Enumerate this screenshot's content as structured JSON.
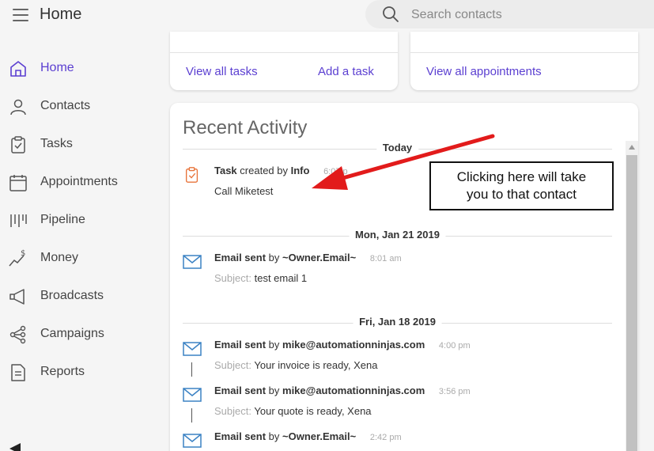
{
  "header": {
    "title": "Home",
    "search_placeholder": "Search contacts"
  },
  "sidebar": {
    "items": [
      {
        "label": "Home",
        "icon": "home-icon",
        "active": true
      },
      {
        "label": "Contacts",
        "icon": "person-icon"
      },
      {
        "label": "Tasks",
        "icon": "clipboard-icon"
      },
      {
        "label": "Appointments",
        "icon": "calendar-icon"
      },
      {
        "label": "Pipeline",
        "icon": "pipeline-icon"
      },
      {
        "label": "Money",
        "icon": "money-icon"
      },
      {
        "label": "Broadcasts",
        "icon": "megaphone-icon"
      },
      {
        "label": "Campaigns",
        "icon": "campaigns-icon"
      },
      {
        "label": "Reports",
        "icon": "report-icon"
      }
    ]
  },
  "cards": {
    "view_all_tasks": "View all tasks",
    "add_task": "Add a task",
    "view_all_appointments": "View all appointments"
  },
  "activity": {
    "title": "Recent Activity",
    "groups": [
      {
        "date": "Today",
        "entries": [
          {
            "type": "Task",
            "verb": "created by",
            "actor": "Info",
            "time": "6:07 p",
            "detail": "Call Miketest"
          }
        ]
      },
      {
        "date": "Mon, Jan 21 2019",
        "entries": [
          {
            "type": "Email sent",
            "verb": "by",
            "actor": "~Owner.Email~",
            "time": "8:01 am",
            "subject_label": "Subject:",
            "subject": "test email 1"
          }
        ]
      },
      {
        "date": "Fri, Jan 18 2019",
        "entries": [
          {
            "type": "Email sent",
            "verb": "by",
            "actor": "mike@automationninjas.com",
            "time": "4:00 pm",
            "subject_label": "Subject:",
            "subject": "Your invoice is ready, Xena"
          },
          {
            "type": "Email sent",
            "verb": "by",
            "actor": "mike@automationninjas.com",
            "time": "3:56 pm",
            "subject_label": "Subject:",
            "subject": "Your quote is ready, Xena"
          },
          {
            "type": "Email sent",
            "verb": "by",
            "actor": "~Owner.Email~",
            "time": "2:42 pm"
          }
        ]
      }
    ]
  },
  "callout": {
    "line1": "Clicking here will take",
    "line2": "you to that contact"
  },
  "colors": {
    "accent": "#5b3fd1",
    "task_icon": "#e8743b",
    "email_icon": "#3b82c4",
    "arrow": "#e21b1b"
  }
}
